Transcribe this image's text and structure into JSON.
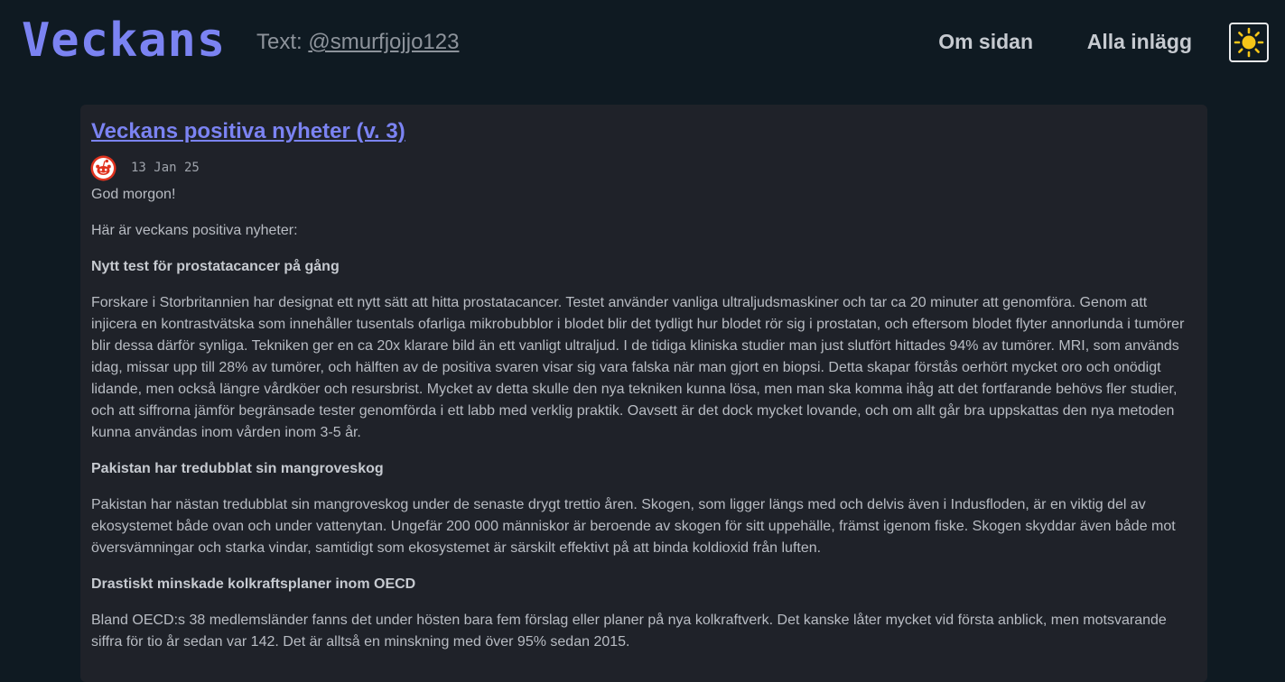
{
  "header": {
    "brand": "Veckans",
    "byline_prefix": "Text: ",
    "byline_author": "@smurfjojjo123",
    "nav": {
      "about": "Om sidan",
      "all_posts": "Alla inlägg"
    },
    "theme_toggle_icon": "sun-icon"
  },
  "post": {
    "title": "Veckans positiva nyheter (v. 3)",
    "date": "13 Jan 25",
    "avatar_icon": "reddit-icon",
    "paragraphs": [
      {
        "type": "text",
        "text": "God morgon!"
      },
      {
        "type": "text",
        "text": "Här är veckans positiva nyheter:"
      },
      {
        "type": "heading",
        "text": "Nytt test för prostatacancer på gång"
      },
      {
        "type": "text",
        "text": "Forskare i Storbritannien har designat ett nytt sätt att hitta prostatacancer. Testet använder vanliga ultraljudsmaskiner och tar ca 20 minuter att genomföra. Genom att injicera en kontrastvätska som innehåller tusentals ofarliga mikrobubblor i blodet blir det tydligt hur blodet rör sig i prostatan, och eftersom blodet flyter annorlunda i tumörer blir dessa därför synliga. Tekniken ger en ca 20x klarare bild än ett vanligt ultraljud. I de tidiga kliniska studier man just slutfört hittades 94% av tumörer. MRI, som används idag, missar upp till 28% av tumörer, och hälften av de positiva svaren visar sig vara falska när man gjort en biopsi. Detta skapar förstås oerhört mycket oro och onödigt lidande, men också längre vårdköer och resursbrist. Mycket av detta skulle den nya tekniken kunna lösa, men man ska komma ihåg att det fortfarande behövs fler studier, och att siffrorna jämför begränsade tester genomförda i ett labb med verklig praktik. Oavsett är det dock mycket lovande, och om allt går bra uppskattas den nya metoden kunna användas inom vården inom 3-5 år."
      },
      {
        "type": "heading",
        "text": "Pakistan har tredubblat sin mangroveskog"
      },
      {
        "type": "text",
        "text": "Pakistan har nästan tredubblat sin mangroveskog under de senaste drygt trettio åren. Skogen, som ligger längs med och delvis även i Indusfloden, är en viktig del av ekosystemet både ovan och under vattenytan. Ungefär 200 000 människor är beroende av skogen för sitt uppehälle, främst igenom fiske. Skogen skyddar även både mot översvämningar och starka vindar, samtidigt som ekosystemet är särskilt effektivt på att binda koldioxid från luften."
      },
      {
        "type": "heading",
        "text": "Drastiskt minskade kolkraftsplaner inom OECD"
      },
      {
        "type": "text",
        "text": "Bland OECD:s 38 medlemsländer fanns det under hösten bara fem förslag eller planer på nya kolkraftverk. Det kanske låter mycket vid första anblick, men motsvarande siffra för tio år sedan var 142. Det är alltså en minskning med över 95% sedan 2015."
      }
    ]
  },
  "colors": {
    "page_bg": "#0f1a22",
    "card_bg": "#1f2229",
    "accent": "#7b83f2",
    "text": "#b8bcc3",
    "sun": "#f5c518",
    "reddit": "#e0331f"
  }
}
